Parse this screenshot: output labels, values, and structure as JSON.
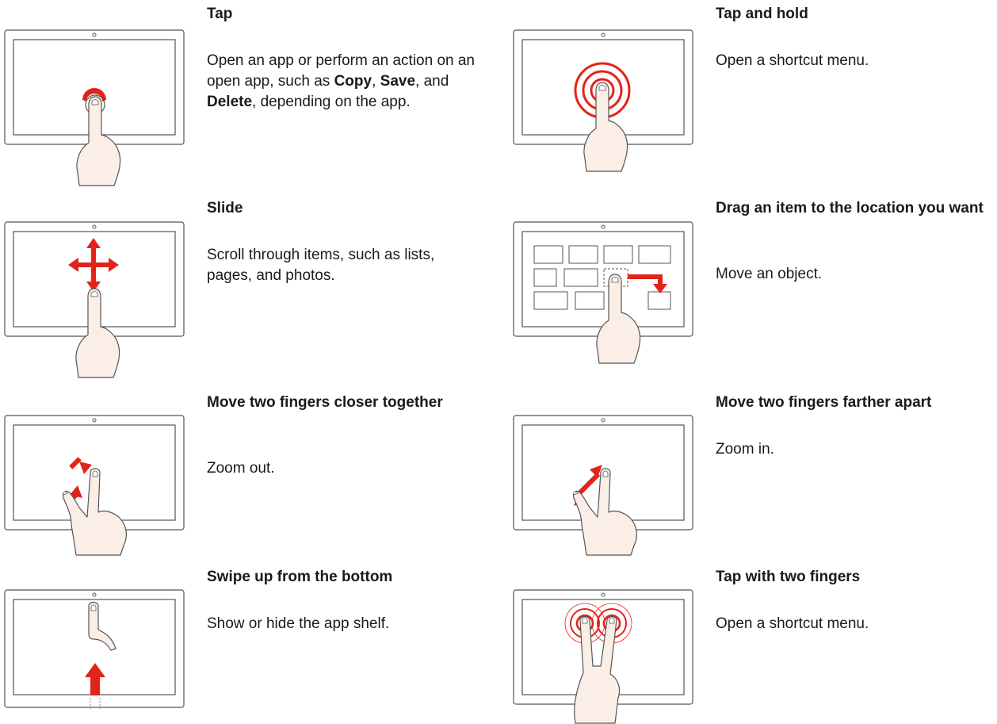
{
  "colors": {
    "accent": "#e2231a",
    "hand_fill": "#fbeee6",
    "outline": "#555555"
  },
  "gestures": [
    {
      "title": "Tap",
      "desc_parts": [
        "Open an app or perform an action on an open app, such as ",
        "Copy",
        ", ",
        "Save",
        ", and ",
        "Delete",
        ", depending on the app."
      ]
    },
    {
      "title": "Tap and hold",
      "desc": "Open a shortcut menu."
    },
    {
      "title": "Slide",
      "desc": "Scroll through items, such as lists, pages, and photos."
    },
    {
      "title": "Drag an item to the location you want",
      "desc": "Move an object."
    },
    {
      "title": "Move two fingers closer together",
      "desc": "Zoom out."
    },
    {
      "title": "Move two fingers farther apart",
      "desc": "Zoom in."
    },
    {
      "title": "Swipe up from the bottom",
      "desc": "Show or hide the app shelf."
    },
    {
      "title": "Tap with two fingers",
      "desc": "Open a shortcut menu."
    }
  ]
}
